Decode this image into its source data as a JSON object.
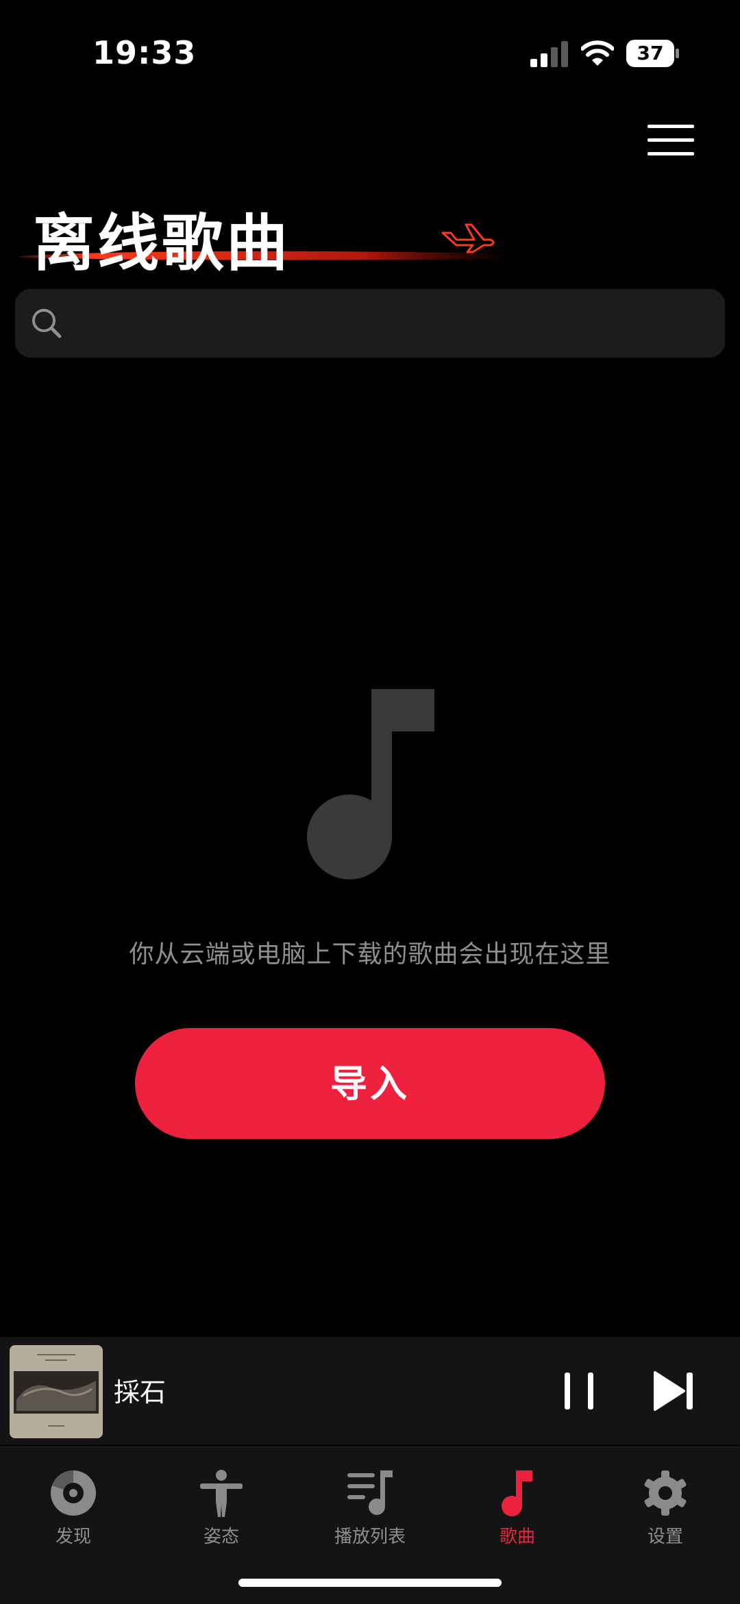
{
  "status_bar": {
    "time": "19:33",
    "battery": "37",
    "icons": [
      "signal-icon",
      "wifi-icon",
      "battery-icon"
    ]
  },
  "header": {
    "title": "离线歌曲",
    "menu_icon": "hamburger-menu-icon",
    "decoration_icon": "airplane-icon"
  },
  "search": {
    "icon": "search-icon",
    "placeholder": "",
    "value": ""
  },
  "empty_state": {
    "icon": "music-note-icon",
    "message": "你从云端或电脑上下载的歌曲会出现在这里",
    "button_label": "导入"
  },
  "mini_player": {
    "song_title": "採石",
    "controls": [
      "pause-icon",
      "next-track-icon"
    ]
  },
  "tab_bar": {
    "tabs": [
      {
        "label": "发现",
        "icon": "disc-icon"
      },
      {
        "label": "姿态",
        "icon": "person-icon"
      },
      {
        "label": "播放列表",
        "icon": "playlist-icon"
      },
      {
        "label": "歌曲",
        "icon": "music-note-icon",
        "active": true
      },
      {
        "label": "设置",
        "icon": "gear-icon"
      }
    ]
  },
  "colors": {
    "background": "#000000",
    "accent": "#ee223e",
    "surface": "#1c1c1e",
    "secondary_text": "#8e8e93",
    "inactive_icon": "#8a8a8a"
  }
}
